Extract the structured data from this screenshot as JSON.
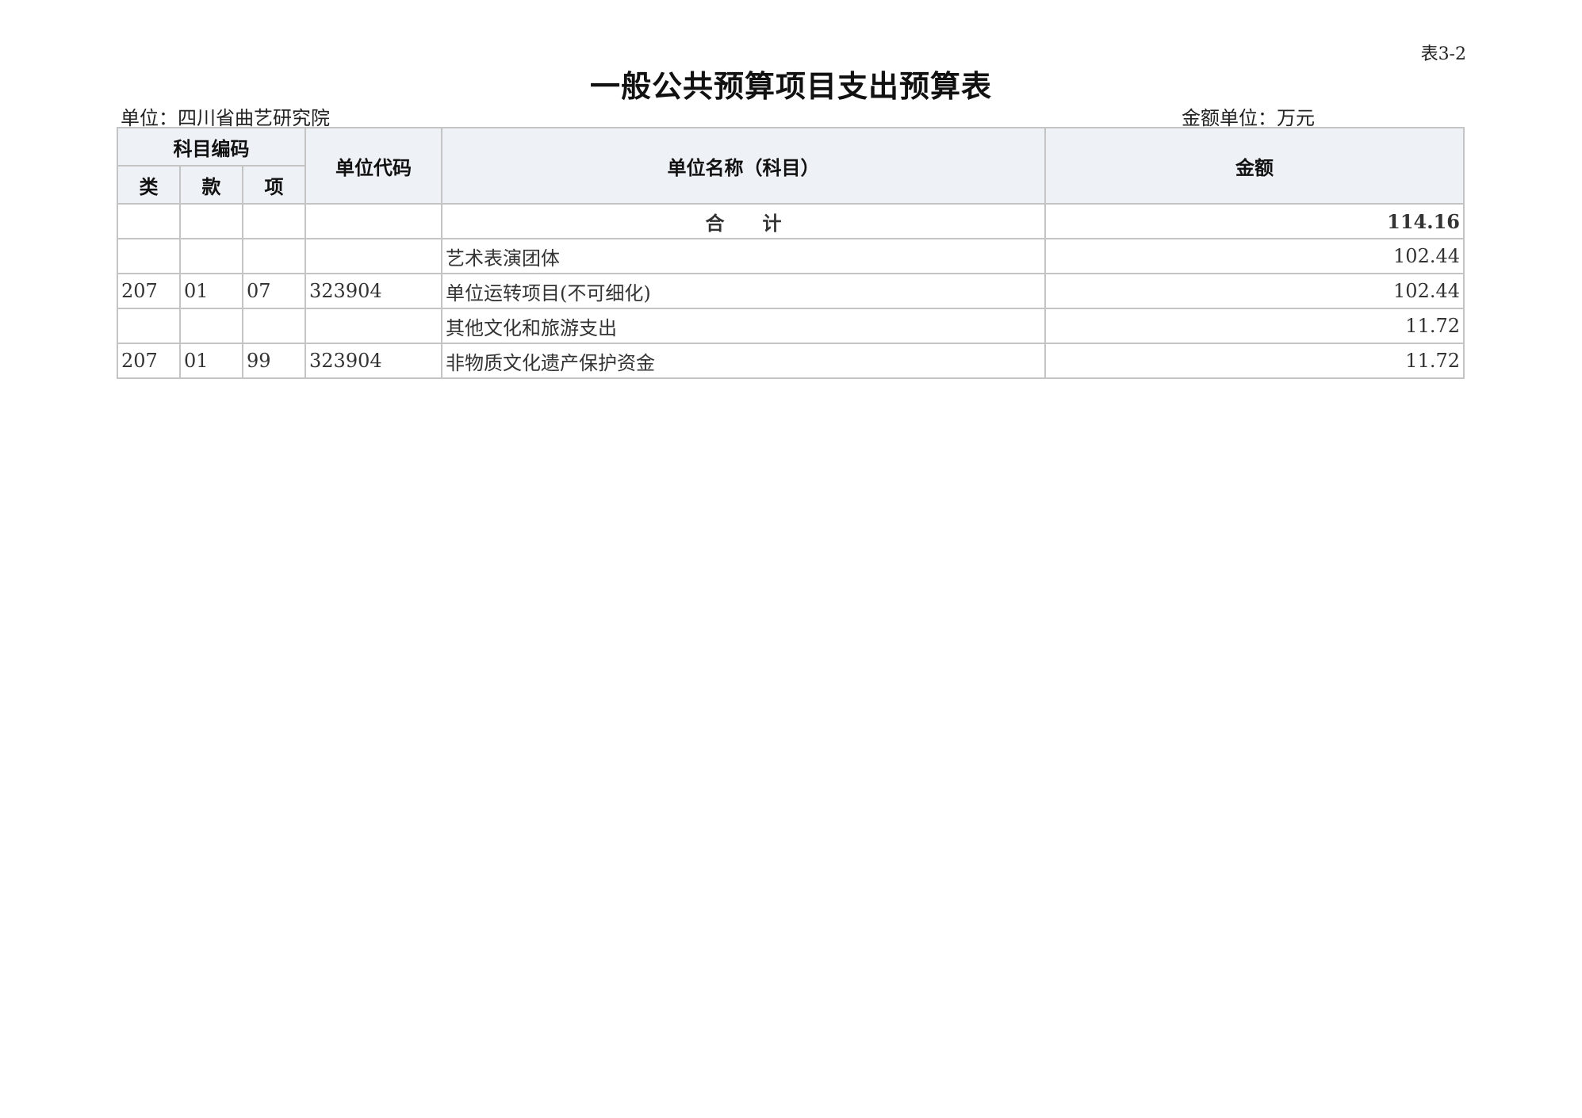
{
  "doc": {
    "table_no": "表3-2",
    "title": "一般公共预算项目支出预算表",
    "unit_label": "单位：四川省曲艺研究院",
    "money_unit_label": "金额单位：万元"
  },
  "headers": {
    "subject_code": "科目编码",
    "lei": "类",
    "kuan": "款",
    "xiang": "项",
    "unit_code": "单位代码",
    "unit_name": "单位名称（科目）",
    "amount": "金额"
  },
  "total": {
    "label": "合　　计",
    "amount": "114.16"
  },
  "rows": [
    {
      "lei": "",
      "kuan": "",
      "xiang": "",
      "unit_code": "",
      "name": "艺术表演团体",
      "amount": "102.44"
    },
    {
      "lei": "207",
      "kuan": "01",
      "xiang": "07",
      "unit_code": "323904",
      "name": "单位运转项目(不可细化)",
      "amount": "102.44"
    },
    {
      "lei": "",
      "kuan": "",
      "xiang": "",
      "unit_code": "",
      "name": "其他文化和旅游支出",
      "amount": "11.72"
    },
    {
      "lei": "207",
      "kuan": "01",
      "xiang": "99",
      "unit_code": "323904",
      "name": "非物质文化遗产保护资金",
      "amount": "11.72"
    }
  ]
}
